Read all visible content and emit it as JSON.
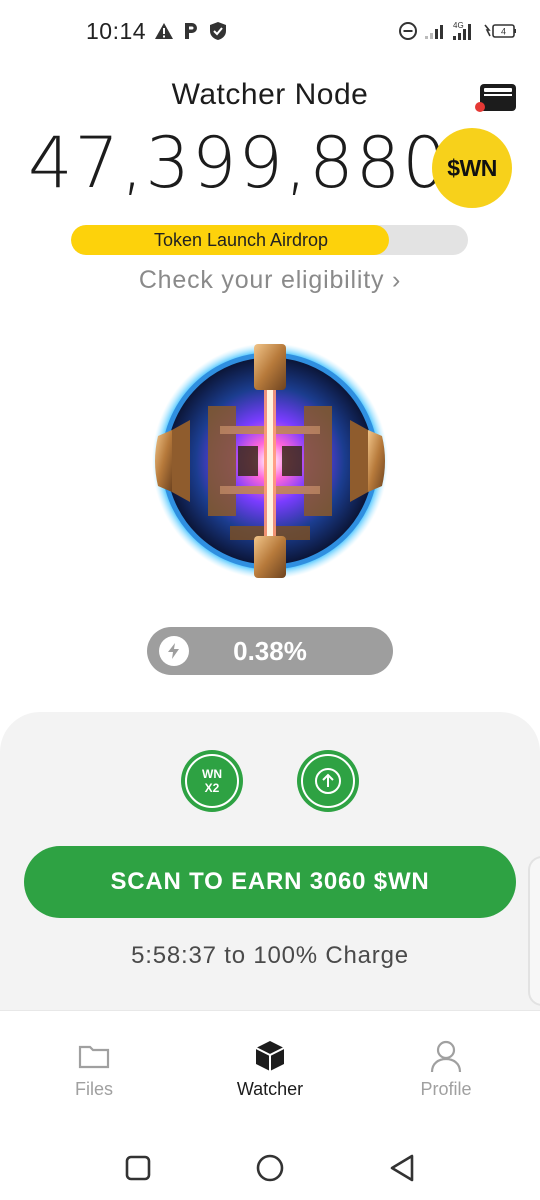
{
  "status_bar": {
    "time": "10:14",
    "network_label": "4G",
    "battery_level": "4",
    "icons": [
      "warning-icon",
      "parking-icon",
      "shield-icon",
      "dnd-icon",
      "signal-icon",
      "signal-4g-icon",
      "battery-icon"
    ]
  },
  "header": {
    "title": "Watcher Node",
    "wallet_icon": "wallet-icon",
    "notification_color": "#e53935"
  },
  "balance": {
    "value": "47,399,880",
    "coin_label": "$WN",
    "coin_color": "#f7d11b"
  },
  "airdrop": {
    "label": "Token Launch Airdrop",
    "progress": 0.8,
    "fill_color": "#fdd20b"
  },
  "eligibility": {
    "label": "Check your eligibility",
    "chevron": "›"
  },
  "orb": {
    "icon": "watcher-orb-image"
  },
  "charge": {
    "icon": "lightning-icon",
    "value": "0.38%"
  },
  "actions": {
    "boost_label_line1": "WN",
    "boost_label_line2": "X2",
    "upgrade_icon": "arrow-up-icon",
    "accent_color": "#2ea243"
  },
  "scan": {
    "label": "SCAN TO EARN 3060 $WN"
  },
  "countdown": {
    "text": "5:58:37 to 100% Charge"
  },
  "nav": {
    "items": [
      {
        "label": "Files",
        "icon": "folder-icon",
        "active": false
      },
      {
        "label": "Watcher",
        "icon": "cube-icon",
        "active": true
      },
      {
        "label": "Profile",
        "icon": "person-icon",
        "active": false
      }
    ]
  },
  "system_nav": {
    "icons": [
      "recents-square-icon",
      "home-circle-icon",
      "back-triangle-icon"
    ]
  }
}
